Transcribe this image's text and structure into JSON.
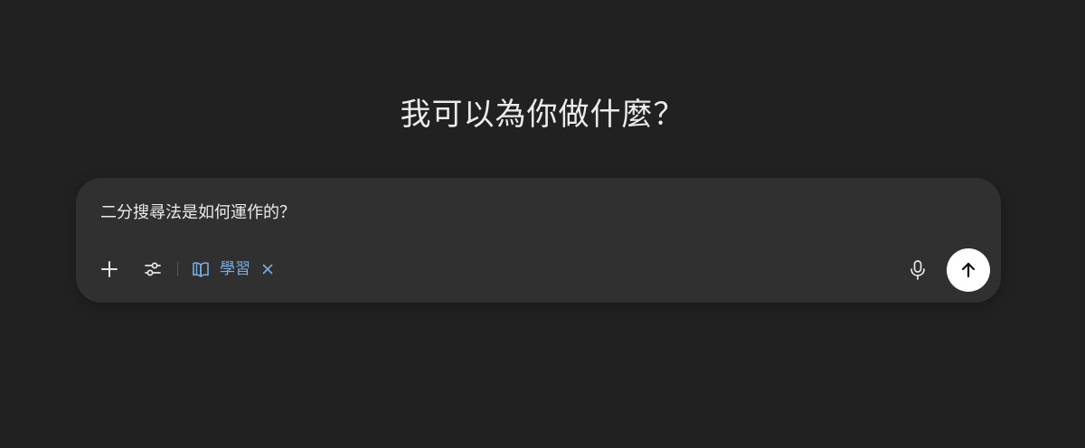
{
  "headline": "我可以為你做什麼？",
  "composer": {
    "prompt_text": "二分搜尋法是如何運作的？",
    "tools": {
      "add_icon": "plus-icon",
      "tools_icon": "sliders-icon",
      "mic_icon": "microphone-icon",
      "send_icon": "arrow-up-icon"
    },
    "chip": {
      "label": "學習",
      "icon": "open-book-icon",
      "close_icon": "close-icon",
      "color": "#78aee6"
    }
  },
  "colors": {
    "background": "#212121",
    "composer_bg": "#303030",
    "text": "#ececec",
    "send_button_bg": "#ffffff"
  }
}
